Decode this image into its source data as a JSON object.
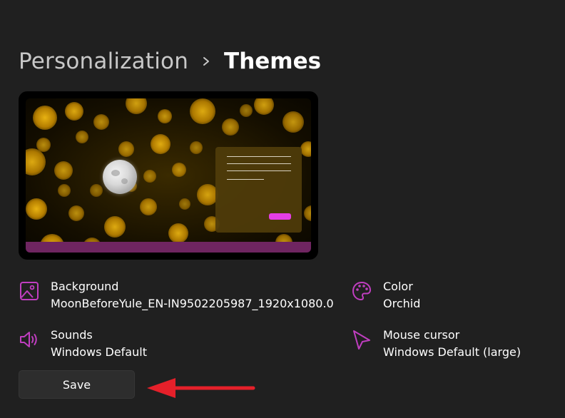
{
  "breadcrumb": {
    "parent": "Personalization",
    "current": "Themes",
    "separator_icon": "chevron-right-icon"
  },
  "preview": {
    "accent_color": "#e43ee4",
    "taskbar_color": "#6f2561"
  },
  "settings": {
    "background": {
      "label": "Background",
      "value": "MoonBeforeYule_EN-IN9502205987_1920x1080.0",
      "icon": "image-icon"
    },
    "color": {
      "label": "Color",
      "value": "Orchid",
      "icon": "palette-icon"
    },
    "sounds": {
      "label": "Sounds",
      "value": "Windows Default",
      "icon": "speaker-icon"
    },
    "mouse_cursor": {
      "label": "Mouse cursor",
      "value": "Windows Default (large)",
      "icon": "cursor-icon"
    }
  },
  "save_button": {
    "label": "Save"
  },
  "colors": {
    "icon_accent": "#c03ec0",
    "annotation_arrow": "#e5202a"
  }
}
